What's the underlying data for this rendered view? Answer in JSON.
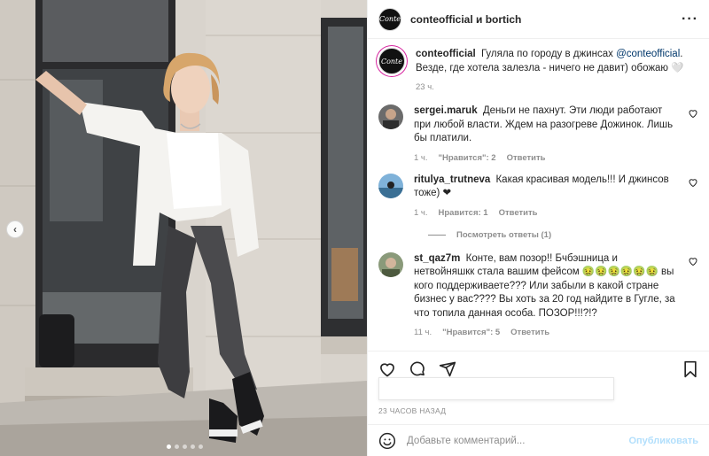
{
  "post": {
    "header_title": "conteofficial и bortich",
    "avatar_text": "Conte"
  },
  "caption": {
    "username": "conteofficial",
    "text_before": "Гуляла по городу в джинсах",
    "mention": "@conteofficial",
    "text_after": ". Везде, где хотела залезла - ничего не давит) обожаю 🤍",
    "time": "23 ч."
  },
  "comments": [
    {
      "username": "sergei.maruk",
      "text": "Деньги не пахнут. Эти люди работают при любой власти. Ждем на разогреве Дожинок. Лишь бы платили.",
      "time": "1 ч.",
      "likes": "\"Нравится\": 2",
      "reply": "Ответить"
    },
    {
      "username": "ritulya_trutneva",
      "text": "Какая красивая модель!!! И джинсов тоже) ❤",
      "time": "1 ч.",
      "likes": "Нравится: 1",
      "reply": "Ответить",
      "view_replies": "Посмотреть ответы (1)"
    },
    {
      "username": "st_qaz7m",
      "text": "Конте, вам позор!! Бчбэшница и нетвойняшкк стала вашим фейсом 🤢🤢🤢🤢🤢🤢 вы кого поддерживаете??? Или забыли в какой стране бизнес у вас???? Вы хоть за 20 год найдите в Гугле, за что топила данная особа. ПОЗОР!!!?!?",
      "time": "11 ч.",
      "likes": "\"Нравится\": 5",
      "reply": "Ответить"
    }
  ],
  "timestamp": "23 ЧАСОВ НАЗАД",
  "add_comment": {
    "placeholder": "Добавьте комментарий...",
    "post_label": "Опубликовать"
  },
  "icons": {
    "more": "more-icon",
    "heart": "heart-icon",
    "comment": "comment-icon",
    "share": "share-icon",
    "bookmark": "bookmark-icon",
    "smile": "emoji-icon",
    "prev": "chevron-left-icon"
  },
  "colors": {
    "text": "#262626",
    "muted": "#8e8e8e",
    "link": "#00376b",
    "post_button": "#b2dffc",
    "story_ring": "#d6249f"
  },
  "carousel": {
    "slides": 5,
    "active": 1
  }
}
